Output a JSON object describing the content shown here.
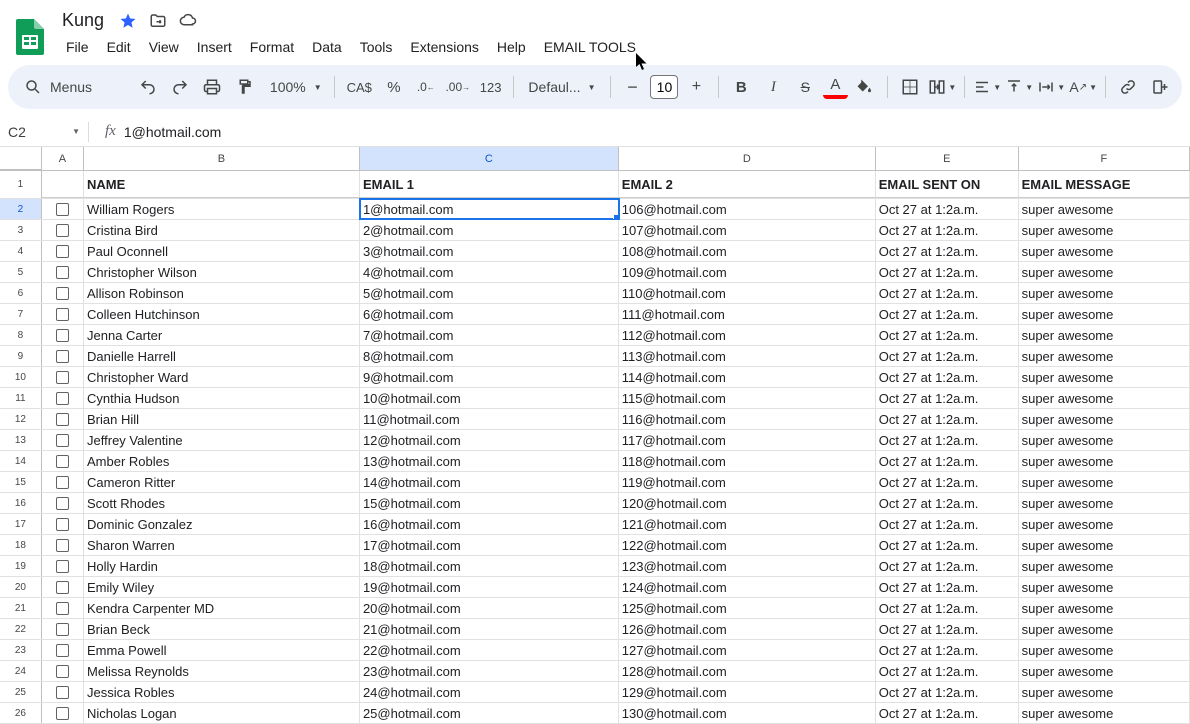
{
  "doc": {
    "title": "Kung"
  },
  "menus": {
    "file": "File",
    "edit": "Edit",
    "view": "View",
    "insert": "Insert",
    "format": "Format",
    "data": "Data",
    "tools": "Tools",
    "extensions": "Extensions",
    "help": "Help",
    "email_tools": "EMAIL TOOLS",
    "menus_label": "Menus"
  },
  "toolbar": {
    "zoom": "100%",
    "currency": "CA$",
    "percent": "%",
    "font": "Defaul...",
    "size": "10",
    "num123": "123"
  },
  "fxbar": {
    "cellref": "C2",
    "fx": "fx",
    "formula": "1@hotmail.com"
  },
  "cols": {
    "a": "A",
    "b": "B",
    "c": "C",
    "d": "D",
    "e": "E",
    "f": "F"
  },
  "headers": {
    "name": "NAME",
    "email1": "EMAIL 1",
    "email2": "EMAIL 2",
    "sent": "EMAIL SENT ON",
    "msg": "EMAIL MESSAGE"
  },
  "rows": [
    {
      "n": "2",
      "name": "William Rogers",
      "e1": "1@hotmail.com",
      "e2": "106@hotmail.com",
      "sent": "Oct 27 at 1:2a.m.",
      "msg": "super awesome"
    },
    {
      "n": "3",
      "name": "Cristina Bird",
      "e1": "2@hotmail.com",
      "e2": "107@hotmail.com",
      "sent": "Oct 27 at 1:2a.m.",
      "msg": "super awesome"
    },
    {
      "n": "4",
      "name": "Paul Oconnell",
      "e1": "3@hotmail.com",
      "e2": "108@hotmail.com",
      "sent": "Oct 27 at 1:2a.m.",
      "msg": "super awesome"
    },
    {
      "n": "5",
      "name": "Christopher Wilson",
      "e1": "4@hotmail.com",
      "e2": "109@hotmail.com",
      "sent": "Oct 27 at 1:2a.m.",
      "msg": "super awesome"
    },
    {
      "n": "6",
      "name": "Allison Robinson",
      "e1": "5@hotmail.com",
      "e2": "110@hotmail.com",
      "sent": "Oct 27 at 1:2a.m.",
      "msg": "super awesome"
    },
    {
      "n": "7",
      "name": "Colleen Hutchinson",
      "e1": "6@hotmail.com",
      "e2": "111@hotmail.com",
      "sent": "Oct 27 at 1:2a.m.",
      "msg": "super awesome"
    },
    {
      "n": "8",
      "name": "Jenna Carter",
      "e1": "7@hotmail.com",
      "e2": "112@hotmail.com",
      "sent": "Oct 27 at 1:2a.m.",
      "msg": "super awesome"
    },
    {
      "n": "9",
      "name": "Danielle Harrell",
      "e1": "8@hotmail.com",
      "e2": "113@hotmail.com",
      "sent": "Oct 27 at 1:2a.m.",
      "msg": "super awesome"
    },
    {
      "n": "10",
      "name": "Christopher Ward",
      "e1": "9@hotmail.com",
      "e2": "114@hotmail.com",
      "sent": "Oct 27 at 1:2a.m.",
      "msg": "super awesome"
    },
    {
      "n": "11",
      "name": "Cynthia Hudson",
      "e1": "10@hotmail.com",
      "e2": "115@hotmail.com",
      "sent": "Oct 27 at 1:2a.m.",
      "msg": "super awesome"
    },
    {
      "n": "12",
      "name": "Brian Hill",
      "e1": "11@hotmail.com",
      "e2": "116@hotmail.com",
      "sent": "Oct 27 at 1:2a.m.",
      "msg": "super awesome"
    },
    {
      "n": "13",
      "name": "Jeffrey Valentine",
      "e1": "12@hotmail.com",
      "e2": "117@hotmail.com",
      "sent": "Oct 27 at 1:2a.m.",
      "msg": "super awesome"
    },
    {
      "n": "14",
      "name": "Amber Robles",
      "e1": "13@hotmail.com",
      "e2": "118@hotmail.com",
      "sent": "Oct 27 at 1:2a.m.",
      "msg": "super awesome"
    },
    {
      "n": "15",
      "name": "Cameron Ritter",
      "e1": "14@hotmail.com",
      "e2": "119@hotmail.com",
      "sent": "Oct 27 at 1:2a.m.",
      "msg": "super awesome"
    },
    {
      "n": "16",
      "name": "Scott Rhodes",
      "e1": "15@hotmail.com",
      "e2": "120@hotmail.com",
      "sent": "Oct 27 at 1:2a.m.",
      "msg": "super awesome"
    },
    {
      "n": "17",
      "name": "Dominic Gonzalez",
      "e1": "16@hotmail.com",
      "e2": "121@hotmail.com",
      "sent": "Oct 27 at 1:2a.m.",
      "msg": "super awesome"
    },
    {
      "n": "18",
      "name": "Sharon Warren",
      "e1": "17@hotmail.com",
      "e2": "122@hotmail.com",
      "sent": "Oct 27 at 1:2a.m.",
      "msg": "super awesome"
    },
    {
      "n": "19",
      "name": "Holly Hardin",
      "e1": "18@hotmail.com",
      "e2": "123@hotmail.com",
      "sent": "Oct 27 at 1:2a.m.",
      "msg": "super awesome"
    },
    {
      "n": "20",
      "name": "Emily Wiley",
      "e1": "19@hotmail.com",
      "e2": "124@hotmail.com",
      "sent": "Oct 27 at 1:2a.m.",
      "msg": "super awesome"
    },
    {
      "n": "21",
      "name": "Kendra Carpenter MD",
      "e1": "20@hotmail.com",
      "e2": "125@hotmail.com",
      "sent": "Oct 27 at 1:2a.m.",
      "msg": "super awesome"
    },
    {
      "n": "22",
      "name": "Brian Beck",
      "e1": "21@hotmail.com",
      "e2": "126@hotmail.com",
      "sent": "Oct 27 at 1:2a.m.",
      "msg": "super awesome"
    },
    {
      "n": "23",
      "name": "Emma Powell",
      "e1": "22@hotmail.com",
      "e2": "127@hotmail.com",
      "sent": "Oct 27 at 1:2a.m.",
      "msg": "super awesome"
    },
    {
      "n": "24",
      "name": "Melissa Reynolds",
      "e1": "23@hotmail.com",
      "e2": "128@hotmail.com",
      "sent": "Oct 27 at 1:2a.m.",
      "msg": "super awesome"
    },
    {
      "n": "25",
      "name": "Jessica Robles",
      "e1": "24@hotmail.com",
      "e2": "129@hotmail.com",
      "sent": "Oct 27 at 1:2a.m.",
      "msg": "super awesome"
    },
    {
      "n": "26",
      "name": "Nicholas Logan",
      "e1": "25@hotmail.com",
      "e2": "130@hotmail.com",
      "sent": "Oct 27 at 1:2a.m.",
      "msg": "super awesome"
    }
  ]
}
